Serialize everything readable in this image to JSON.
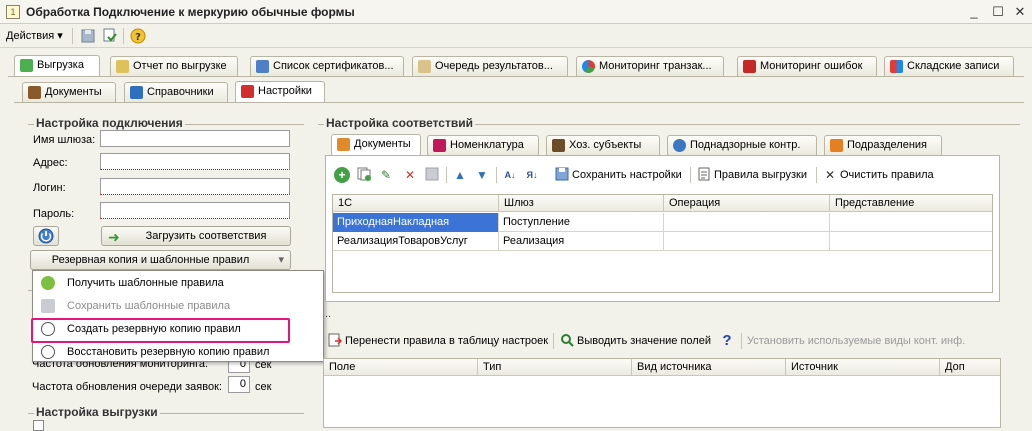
{
  "window": {
    "title": "Обработка  Подключение к меркурию обычные формы"
  },
  "toolbar": {
    "actions_label": "Действия"
  },
  "main_tabs": [
    {
      "label": "Выгрузка"
    },
    {
      "label": "Отчет по выгрузке"
    },
    {
      "label": "Список сертификатов..."
    },
    {
      "label": "Очередь результатов..."
    },
    {
      "label": "Мониторинг транзак..."
    },
    {
      "label": "Мониторинг ошибок"
    },
    {
      "label": "Складские записи"
    }
  ],
  "sub_tabs": [
    {
      "label": "Документы"
    },
    {
      "label": "Справочники"
    },
    {
      "label": "Настройки"
    }
  ],
  "connection": {
    "group_title": "Настройка подключения",
    "gateway_label": "Имя шлюза:",
    "address_label": "Адрес:",
    "login_label": "Логин:",
    "password_label": "Пароль:",
    "load_button": "Загрузить соответствия",
    "backup_dropdown": "Резервная копия и шаблонные правил"
  },
  "menu": {
    "items": [
      {
        "label": "Получить шаблонные правила"
      },
      {
        "label": "Сохранить шаблонные правила"
      },
      {
        "label": "Создать резервную копию правил"
      },
      {
        "label": "Восстановить резервную копию правил"
      }
    ]
  },
  "monitoring": {
    "freq_monitoring_label": "Частота обновления мониторинга:",
    "freq_monitoring_value": "0",
    "freq_queue_label": "Частота обновления очереди заявок:",
    "freq_queue_value": "0",
    "unit": "сек"
  },
  "export_settings": {
    "group_title": "Настройка выгрузки"
  },
  "matching": {
    "group_title": "Настройка соответствий",
    "tabs": [
      {
        "label": "Документы"
      },
      {
        "label": "Номенклатура"
      },
      {
        "label": "Хоз. субъекты"
      },
      {
        "label": "Поднадзорные контр."
      },
      {
        "label": "Подразделения"
      }
    ],
    "toolbar": {
      "save_settings": "Сохранить настройки",
      "export_rules": "Правила выгрузки",
      "clear_rules": "Очистить правила"
    },
    "columns": [
      "1С",
      "Шлюз",
      "Операция",
      "Представление"
    ],
    "rows": [
      [
        "ПриходнаяНакладная",
        "Поступление",
        "",
        ""
      ],
      [
        "РеализацияТоваровУслуг",
        "Реализация",
        "",
        ""
      ]
    ]
  },
  "lower": {
    "dots": "..",
    "transfer_rules": "Перенести правила в таблицу настроек",
    "show_fields": "Выводить значение полей",
    "set_contact_types": "Установить используемые виды конт. инф.",
    "columns": [
      "Поле",
      "Тип",
      "Вид источника",
      "Источник",
      "Доп"
    ]
  },
  "colors": {
    "highlight": "#e5137d",
    "selection": "#3b74d6"
  }
}
